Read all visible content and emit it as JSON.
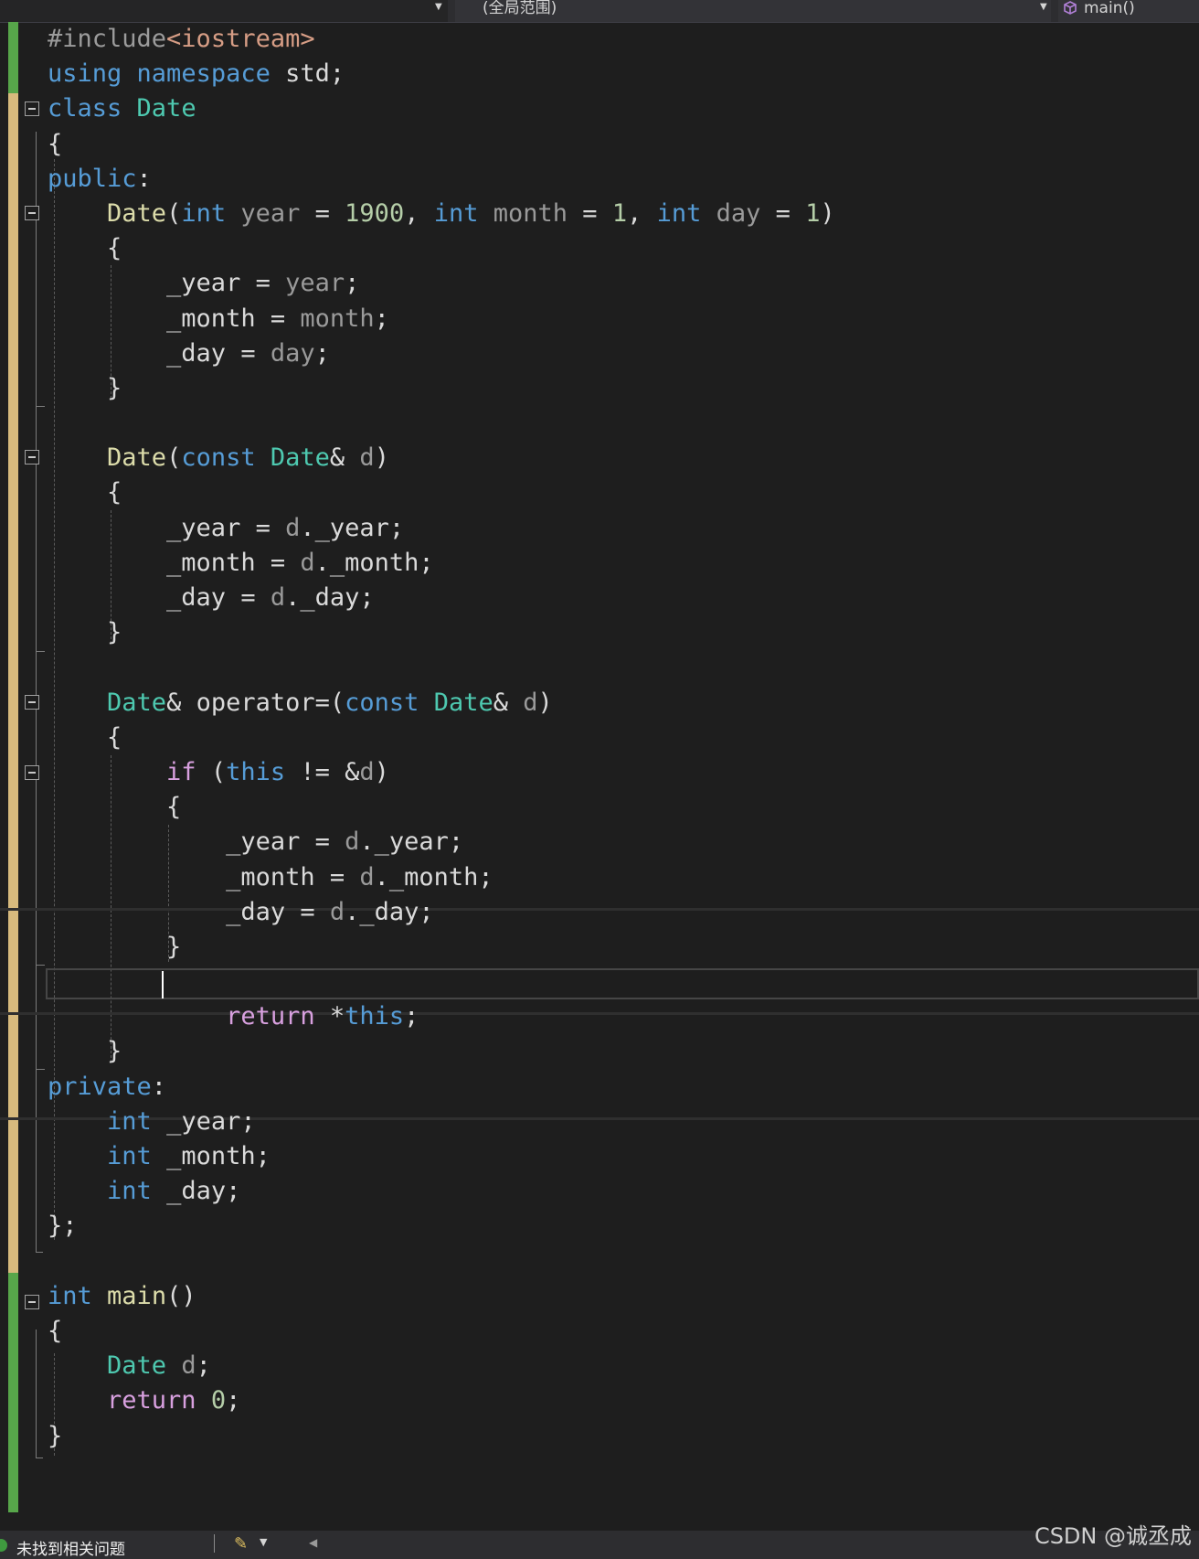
{
  "topbar": {
    "scope_label": "(全局范围)",
    "member_label": "main()",
    "cube_icon": "class-cube-icon"
  },
  "code_lines": [
    [
      {
        "c": "pp",
        "t": "#include"
      },
      {
        "c": "s",
        "t": "<iostream>"
      }
    ],
    [
      {
        "c": "k",
        "t": "using"
      },
      {
        "c": "m",
        "t": " "
      },
      {
        "c": "k",
        "t": "namespace"
      },
      {
        "c": "m",
        "t": " std;"
      }
    ],
    [
      {
        "c": "k",
        "t": "class"
      },
      {
        "c": "m",
        "t": " "
      },
      {
        "c": "t",
        "t": "Date"
      }
    ],
    [
      {
        "c": "m",
        "t": "{"
      }
    ],
    [
      {
        "c": "k",
        "t": "public"
      },
      {
        "c": "m",
        "t": ":"
      }
    ],
    [
      {
        "c": "m",
        "t": "    "
      },
      {
        "c": "f",
        "t": "Date"
      },
      {
        "c": "m",
        "t": "("
      },
      {
        "c": "k",
        "t": "int"
      },
      {
        "c": "pa",
        "t": " year"
      },
      {
        "c": "m",
        "t": " = "
      },
      {
        "c": "n",
        "t": "1900"
      },
      {
        "c": "m",
        "t": ", "
      },
      {
        "c": "k",
        "t": "int"
      },
      {
        "c": "pa",
        "t": " month"
      },
      {
        "c": "m",
        "t": " = "
      },
      {
        "c": "n",
        "t": "1"
      },
      {
        "c": "m",
        "t": ", "
      },
      {
        "c": "k",
        "t": "int"
      },
      {
        "c": "pa",
        "t": " day"
      },
      {
        "c": "m",
        "t": " = "
      },
      {
        "c": "n",
        "t": "1"
      },
      {
        "c": "m",
        "t": ")"
      }
    ],
    [
      {
        "c": "m",
        "t": "    {"
      }
    ],
    [
      {
        "c": "m",
        "t": "        _year = "
      },
      {
        "c": "pa",
        "t": "year"
      },
      {
        "c": "m",
        "t": ";"
      }
    ],
    [
      {
        "c": "m",
        "t": "        _month = "
      },
      {
        "c": "pa",
        "t": "month"
      },
      {
        "c": "m",
        "t": ";"
      }
    ],
    [
      {
        "c": "m",
        "t": "        _day = "
      },
      {
        "c": "pa",
        "t": "day"
      },
      {
        "c": "m",
        "t": ";"
      }
    ],
    [
      {
        "c": "m",
        "t": "    }"
      }
    ],
    [
      {
        "c": "m",
        "t": ""
      }
    ],
    [
      {
        "c": "m",
        "t": "    "
      },
      {
        "c": "f",
        "t": "Date"
      },
      {
        "c": "m",
        "t": "("
      },
      {
        "c": "k",
        "t": "const"
      },
      {
        "c": "m",
        "t": " "
      },
      {
        "c": "t",
        "t": "Date"
      },
      {
        "c": "m",
        "t": "& "
      },
      {
        "c": "pa",
        "t": "d"
      },
      {
        "c": "m",
        "t": ")"
      }
    ],
    [
      {
        "c": "m",
        "t": "    {"
      }
    ],
    [
      {
        "c": "m",
        "t": "        _year = "
      },
      {
        "c": "pa",
        "t": "d"
      },
      {
        "c": "m",
        "t": "._year;"
      }
    ],
    [
      {
        "c": "m",
        "t": "        _month = "
      },
      {
        "c": "pa",
        "t": "d"
      },
      {
        "c": "m",
        "t": "._month;"
      }
    ],
    [
      {
        "c": "m",
        "t": "        _day = "
      },
      {
        "c": "pa",
        "t": "d"
      },
      {
        "c": "m",
        "t": "._day;"
      }
    ],
    [
      {
        "c": "m",
        "t": "    }"
      }
    ],
    [
      {
        "c": "m",
        "t": ""
      }
    ],
    [
      {
        "c": "m",
        "t": "    "
      },
      {
        "c": "t",
        "t": "Date"
      },
      {
        "c": "m",
        "t": "& operator=("
      },
      {
        "c": "k",
        "t": "const"
      },
      {
        "c": "m",
        "t": " "
      },
      {
        "c": "t",
        "t": "Date"
      },
      {
        "c": "m",
        "t": "& "
      },
      {
        "c": "pa",
        "t": "d"
      },
      {
        "c": "m",
        "t": ")"
      }
    ],
    [
      {
        "c": "m",
        "t": "    {"
      }
    ],
    [
      {
        "c": "m",
        "t": "        "
      },
      {
        "c": "kc",
        "t": "if"
      },
      {
        "c": "m",
        "t": " ("
      },
      {
        "c": "k",
        "t": "this"
      },
      {
        "c": "m",
        "t": " != &"
      },
      {
        "c": "pa",
        "t": "d"
      },
      {
        "c": "m",
        "t": ")"
      }
    ],
    [
      {
        "c": "m",
        "t": "        {"
      }
    ],
    [
      {
        "c": "m",
        "t": "            _year = "
      },
      {
        "c": "pa",
        "t": "d"
      },
      {
        "c": "m",
        "t": "._year;"
      }
    ],
    [
      {
        "c": "m",
        "t": "            _month = "
      },
      {
        "c": "pa",
        "t": "d"
      },
      {
        "c": "m",
        "t": "._month;"
      }
    ],
    [
      {
        "c": "m",
        "t": "            _day = "
      },
      {
        "c": "pa",
        "t": "d"
      },
      {
        "c": "m",
        "t": "._day;"
      }
    ],
    [
      {
        "c": "m",
        "t": "        }"
      }
    ],
    [
      {
        "c": "m",
        "t": ""
      }
    ],
    [
      {
        "c": "m",
        "t": "            "
      },
      {
        "c": "kc",
        "t": "return"
      },
      {
        "c": "m",
        "t": " *"
      },
      {
        "c": "k",
        "t": "this"
      },
      {
        "c": "m",
        "t": ";"
      }
    ],
    [
      {
        "c": "m",
        "t": "    }"
      }
    ],
    [
      {
        "c": "k",
        "t": "private"
      },
      {
        "c": "m",
        "t": ":"
      }
    ],
    [
      {
        "c": "m",
        "t": "    "
      },
      {
        "c": "k",
        "t": "int"
      },
      {
        "c": "m",
        "t": " _year;"
      }
    ],
    [
      {
        "c": "m",
        "t": "    "
      },
      {
        "c": "k",
        "t": "int"
      },
      {
        "c": "m",
        "t": " _month;"
      }
    ],
    [
      {
        "c": "m",
        "t": "    "
      },
      {
        "c": "k",
        "t": "int"
      },
      {
        "c": "m",
        "t": " _day;"
      }
    ],
    [
      {
        "c": "m",
        "t": "};"
      }
    ],
    [
      {
        "c": "m",
        "t": ""
      }
    ],
    [
      {
        "c": "k",
        "t": "int"
      },
      {
        "c": "m",
        "t": " "
      },
      {
        "c": "f",
        "t": "main"
      },
      {
        "c": "m",
        "t": "()"
      }
    ],
    [
      {
        "c": "m",
        "t": "{"
      }
    ],
    [
      {
        "c": "m",
        "t": "    "
      },
      {
        "c": "t",
        "t": "Date"
      },
      {
        "c": "m",
        "t": " "
      },
      {
        "c": "pa",
        "t": "d"
      },
      {
        "c": "m",
        "t": ";"
      }
    ],
    [
      {
        "c": "m",
        "t": "    "
      },
      {
        "c": "kc",
        "t": "return"
      },
      {
        "c": "m",
        "t": " "
      },
      {
        "c": "n",
        "t": "0"
      },
      {
        "c": "m",
        "t": ";"
      }
    ],
    [
      {
        "c": "m",
        "t": "}"
      }
    ]
  ],
  "colors": {
    "keyword": "#569cd6",
    "control_keyword": "#d8a0df",
    "type": "#4ec9b0",
    "function": "#dcdcaa",
    "number": "#b5cea8",
    "string": "#d69d85",
    "change_saved": "#57a64a",
    "change_unsaved": "#d7ba7d"
  },
  "status": {
    "icon": "check-circle-icon",
    "text": "未找到相关问题",
    "brush_icon": "code-cleanup-brush-icon",
    "scroll_left_icon": "scroll-left-arrow-icon"
  },
  "watermark": "CSDN @诚丞成"
}
